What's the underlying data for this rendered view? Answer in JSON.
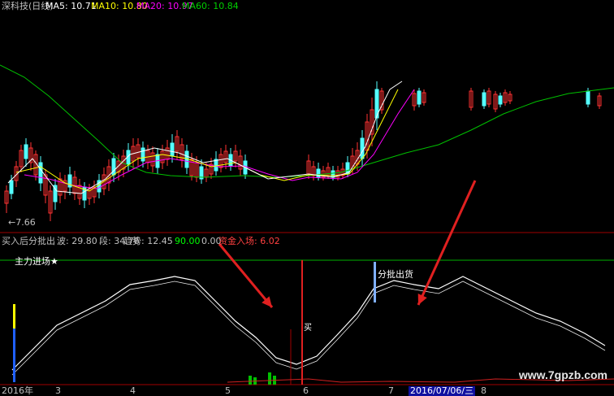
{
  "header": {
    "title": "深科技(日线)",
    "ma5": "MA5: 10.71",
    "ma10": "MA10: 10.80",
    "ma20": "MA20: 10.97",
    "ma60": "MA60: 10.84"
  },
  "price_panel": {
    "low_label": "7.66"
  },
  "indicator_bar": {
    "name": "买入后分批出",
    "wave": "波: 29.80",
    "segment": "段: 34.76",
    "trend": "趋势: 12.45",
    "v1": "90.00",
    "v2": "0.00",
    "capital": "资金入场: 6.02"
  },
  "sub_panel": {
    "main_label": "主力进场★",
    "sell_label": "分批出货",
    "buy_label": "买"
  },
  "x_axis": {
    "labels": [
      "2016年",
      "3",
      "4",
      "5",
      "6",
      "7",
      "2016/07/06/三",
      "8"
    ]
  },
  "watermark": "www.7gpzb.com",
  "colors": {
    "up": "#ff3232",
    "down": "#54ffff",
    "ma5": "#ffffff",
    "ma10": "#ffff00",
    "ma20": "#ff00ff",
    "ma60": "#00c000",
    "arrow": "#e02020"
  }
}
